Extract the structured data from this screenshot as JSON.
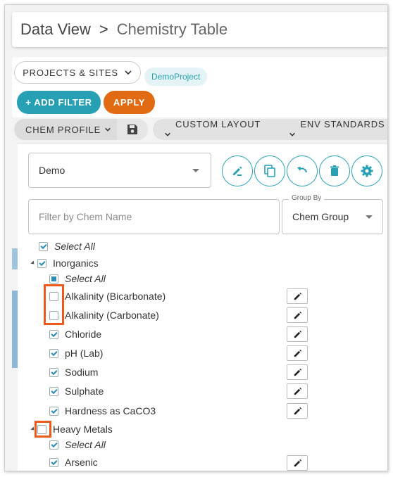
{
  "header": {
    "title": "Data View",
    "separator": ">",
    "subtitle": "Chemistry Table"
  },
  "filters": {
    "projects_label": "PROJECTS & SITES",
    "project_chip": "DemoProject",
    "add_filter_label": "+ ADD FILTER",
    "apply_label": "APPLY"
  },
  "toolbar": {
    "chem_profile_label": "CHEM PROFILE",
    "custom_layout_label": "CUSTOM LAYOUT",
    "env_standards_label": "ENV STANDARDS"
  },
  "profile": {
    "selected": "Demo",
    "filter_placeholder": "Filter by Chem Name",
    "group_by_label": "Group By",
    "group_by_value": "Chem Group"
  },
  "tree": {
    "select_all": "Select All",
    "groups": [
      {
        "name": "Inorganics",
        "select_all": "Select All",
        "items": [
          {
            "label": "Alkalinity (Bicarbonate)",
            "checked": false
          },
          {
            "label": "Alkalinity (Carbonate)",
            "checked": false
          },
          {
            "label": "Chloride",
            "checked": true
          },
          {
            "label": "pH (Lab)",
            "checked": true
          },
          {
            "label": "Sodium",
            "checked": true
          },
          {
            "label": "Sulphate",
            "checked": true
          },
          {
            "label": "Hardness as CaCO3",
            "checked": true
          }
        ]
      },
      {
        "name": "Heavy Metals",
        "select_all": "Select All",
        "items": [
          {
            "label": "Arsenic",
            "checked": true
          }
        ]
      }
    ]
  },
  "colors": {
    "teal": "#27a0b3",
    "orange": "#e06b12",
    "highlight": "#ee5a1c"
  }
}
